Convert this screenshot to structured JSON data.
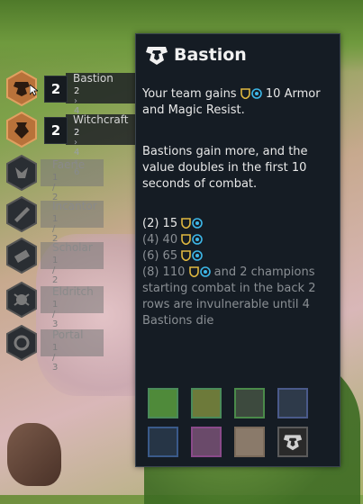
{
  "traits": [
    {
      "name": "Bastion",
      "count": "2",
      "steps": [
        "2",
        "4",
        "6"
      ],
      "active": true
    },
    {
      "name": "Witchcraft",
      "count": "2",
      "steps": [
        "2",
        "4",
        "6"
      ],
      "active": true
    },
    {
      "name": "Faerie",
      "steps_text": "1 / 2",
      "active": false
    },
    {
      "name": "Incantor",
      "steps_text": "1 / 2",
      "active": false
    },
    {
      "name": "Scholar",
      "steps_text": "1 / 2",
      "active": false
    },
    {
      "name": "Eldritch",
      "steps_text": "1 / 3",
      "active": false
    },
    {
      "name": "Portal",
      "steps_text": "1 / 3",
      "active": false
    }
  ],
  "tooltip": {
    "title": "Bastion",
    "desc_prefix": "Your team gains",
    "desc_value": "10",
    "desc_suffix": "Armor and Magic Resist.",
    "desc2": "Bastions gain more, and the value doubles in the first 10 seconds of combat.",
    "tiers": [
      {
        "label": "(2) 15",
        "active": true
      },
      {
        "label": "(4) 40",
        "active": false
      },
      {
        "label": "(6) 65",
        "active": false
      },
      {
        "label": "(8) 110",
        "active": false
      }
    ],
    "tier8_extra": "and 2 champions starting combat in the back 2 rows are invulnerable until 4 Bastions die"
  },
  "champions": [
    {
      "name": "champion-1",
      "color": "#4f8a3a"
    },
    {
      "name": "champion-2",
      "color": "#6d7a3a"
    },
    {
      "name": "champion-3",
      "color": "#3d4a3e"
    },
    {
      "name": "champion-4",
      "color": "#2e3a4a"
    },
    {
      "name": "champion-5",
      "color": "#263546"
    },
    {
      "name": "champion-6",
      "color": "#6a4a6a"
    },
    {
      "name": "champion-7",
      "color": "#8a7a6a"
    },
    {
      "name": "champion-8",
      "color": "#2a2a2a"
    }
  ],
  "colors": {
    "armor": "#e0b840",
    "magic_resist": "#3db7e8",
    "bronze": "#b8723a",
    "dim": "#8a8f94"
  }
}
